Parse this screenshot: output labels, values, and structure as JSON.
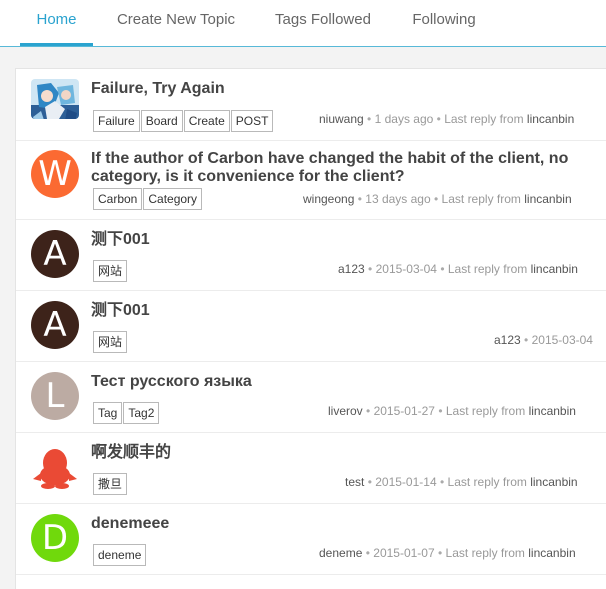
{
  "nav": {
    "tabs": [
      {
        "label": "Home",
        "active": true
      },
      {
        "label": "Create New Topic",
        "active": false
      },
      {
        "label": "Tags Followed",
        "active": false
      },
      {
        "label": "Following",
        "active": false
      }
    ]
  },
  "colors": {
    "accent": "#2aa3cf",
    "nav_border": "#57b9d8"
  },
  "topics": [
    {
      "title": "Failure, Try Again",
      "avatar": {
        "type": "image",
        "name": "anime-avatar-image"
      },
      "tags": [
        "Failure",
        "Board",
        "Create",
        "POST"
      ],
      "author": "niuwang",
      "sep1": "•",
      "time": "1 days ago",
      "sep2": "•",
      "reply_label": "Last reply from",
      "last_reply": "lincanbin"
    },
    {
      "title": "If the author of Carbon have changed the habit of the client, no category, is it convenience for the client?",
      "avatar": {
        "type": "letter",
        "letter": "W",
        "color": "#fb6a32"
      },
      "tags": [
        "Carbon",
        "Category"
      ],
      "author": "wingeong",
      "sep1": "•",
      "time": "13 days ago",
      "sep2": "•",
      "reply_label": "Last reply from",
      "last_reply": "lincanbin"
    },
    {
      "title": "测下001",
      "avatar": {
        "type": "letter",
        "letter": "A",
        "color": "#3d231a"
      },
      "tags": [
        "网站"
      ],
      "author": "a123",
      "sep1": "•",
      "time": "2015-03-04",
      "sep2": "•",
      "reply_label": "Last reply from",
      "last_reply": "lincanbin"
    },
    {
      "title": "测下001",
      "avatar": {
        "type": "letter",
        "letter": "A",
        "color": "#3d231a"
      },
      "tags": [
        "网站"
      ],
      "author": "a123",
      "sep1": "•",
      "time": "2015-03-04",
      "sep2": "",
      "reply_label": "",
      "last_reply": ""
    },
    {
      "title": "Тест русского языка",
      "avatar": {
        "type": "letter",
        "letter": "L",
        "color": "#bcaba3"
      },
      "tags": [
        "Tag",
        "Tag2"
      ],
      "author": "liverov",
      "sep1": "•",
      "time": "2015-01-27",
      "sep2": "•",
      "reply_label": "Last reply from",
      "last_reply": "lincanbin"
    },
    {
      "title": "啊发顺丰的",
      "avatar": {
        "type": "icon",
        "name": "qq-penguin-icon",
        "color": "#ea4a35"
      },
      "tags": [
        "撒旦"
      ],
      "author": "test",
      "sep1": "•",
      "time": "2015-01-14",
      "sep2": "•",
      "reply_label": "Last reply from",
      "last_reply": "lincanbin"
    },
    {
      "title": "denemeee",
      "avatar": {
        "type": "letter",
        "letter": "D",
        "color": "#70d90c"
      },
      "tags": [
        "deneme"
      ],
      "author": "deneme",
      "sep1": "•",
      "time": "2015-01-07",
      "sep2": "•",
      "reply_label": "Last reply from",
      "last_reply": "lincanbin"
    }
  ]
}
